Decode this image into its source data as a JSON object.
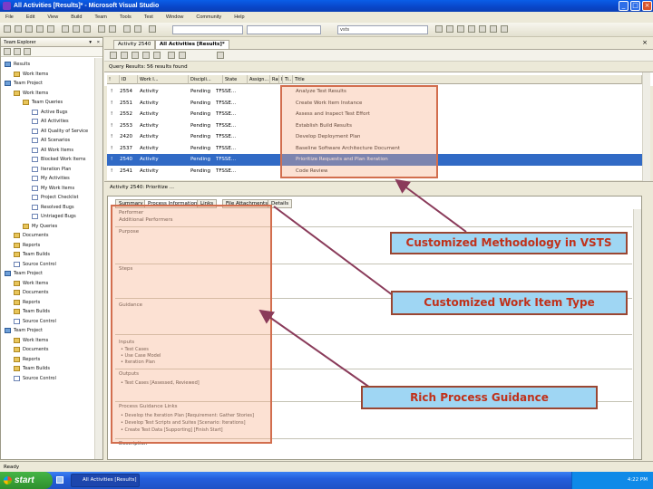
{
  "window": {
    "title": "All Activities [Results]* - Microsoft Visual Studio",
    "controls": [
      "_",
      "□",
      "×"
    ]
  },
  "menu": [
    "File",
    "Edit",
    "View",
    "Build",
    "Team",
    "Tools",
    "Test",
    "Window",
    "Community",
    "Help"
  ],
  "toolbar": {
    "config_value": "",
    "target_value": "vsts"
  },
  "team_explorer": {
    "title": "Team Explorer",
    "items": [
      {
        "label": "Results",
        "indent": 0,
        "icon": "server"
      },
      {
        "label": "Work Items",
        "indent": 1,
        "icon": "folder"
      },
      {
        "label": "Team Project",
        "indent": 0,
        "icon": "server"
      },
      {
        "label": "Work Items",
        "indent": 1,
        "icon": "folder"
      },
      {
        "label": "Team Queries",
        "indent": 2,
        "icon": "folder"
      },
      {
        "label": "Active Bugs",
        "indent": 3,
        "icon": "page"
      },
      {
        "label": "All Activities",
        "indent": 3,
        "icon": "page"
      },
      {
        "label": "All Quality of Service",
        "indent": 3,
        "icon": "page"
      },
      {
        "label": "All Scenarios",
        "indent": 3,
        "icon": "page"
      },
      {
        "label": "All Work Items",
        "indent": 3,
        "icon": "page"
      },
      {
        "label": "Blocked Work Items",
        "indent": 3,
        "icon": "page"
      },
      {
        "label": "Iteration Plan",
        "indent": 3,
        "icon": "page"
      },
      {
        "label": "My Activities",
        "indent": 3,
        "icon": "page"
      },
      {
        "label": "My Work Items",
        "indent": 3,
        "icon": "page"
      },
      {
        "label": "Project Checklist",
        "indent": 3,
        "icon": "page"
      },
      {
        "label": "Resolved Bugs",
        "indent": 3,
        "icon": "page"
      },
      {
        "label": "Untriaged Bugs",
        "indent": 3,
        "icon": "page"
      },
      {
        "label": "My Queries",
        "indent": 2,
        "icon": "folder"
      },
      {
        "label": "Documents",
        "indent": 1,
        "icon": "folder"
      },
      {
        "label": "Reports",
        "indent": 1,
        "icon": "folder"
      },
      {
        "label": "Team Builds",
        "indent": 1,
        "icon": "folder"
      },
      {
        "label": "Source Control",
        "indent": 1,
        "icon": "page"
      },
      {
        "label": "Team Project",
        "indent": 0,
        "icon": "server"
      },
      {
        "label": "Work Items",
        "indent": 1,
        "icon": "folder"
      },
      {
        "label": "Documents",
        "indent": 1,
        "icon": "folder"
      },
      {
        "label": "Reports",
        "indent": 1,
        "icon": "folder"
      },
      {
        "label": "Team Builds",
        "indent": 1,
        "icon": "folder"
      },
      {
        "label": "Source Control",
        "indent": 1,
        "icon": "page"
      },
      {
        "label": "Team Project",
        "indent": 0,
        "icon": "server"
      },
      {
        "label": "Work Items",
        "indent": 1,
        "icon": "folder"
      },
      {
        "label": "Documents",
        "indent": 1,
        "icon": "folder"
      },
      {
        "label": "Reports",
        "indent": 1,
        "icon": "folder"
      },
      {
        "label": "Team Builds",
        "indent": 1,
        "icon": "folder"
      },
      {
        "label": "Source Control",
        "indent": 1,
        "icon": "page"
      }
    ]
  },
  "doc_tabs": [
    "Activity 2540",
    "All Activities [Results]*"
  ],
  "results_header": "Query Results: 56 results found",
  "grid": {
    "columns": [
      "!",
      "ID",
      "Work I...",
      "Discipli...",
      "State",
      "Assign...",
      "Rank",
      "Iter...",
      "Ti...",
      "Title"
    ],
    "rows": [
      {
        "id": "2554",
        "type": "Activity",
        "state": "Pending",
        "assigned": "TFSSE...",
        "title": "Analyze Test Results",
        "selected": false
      },
      {
        "id": "2551",
        "type": "Activity",
        "state": "Pending",
        "assigned": "TFSSE...",
        "title": "Create Work Item Instance",
        "selected": false
      },
      {
        "id": "2552",
        "type": "Activity",
        "state": "Pending",
        "assigned": "TFSSE...",
        "title": "Assess and Inspect Test Effort",
        "selected": false
      },
      {
        "id": "2553",
        "type": "Activity",
        "state": "Pending",
        "assigned": "TFSSE...",
        "title": "Establish Build Results",
        "selected": false
      },
      {
        "id": "2420",
        "type": "Activity",
        "state": "Pending",
        "assigned": "TFSSE...",
        "title": "Develop Deployment Plan",
        "selected": false
      },
      {
        "id": "2537",
        "type": "Activity",
        "state": "Pending",
        "assigned": "TFSSE...",
        "title": "Baseline Software Architecture Document",
        "selected": false
      },
      {
        "id": "2540",
        "type": "Activity",
        "state": "Pending",
        "assigned": "TFSSE...",
        "title": "Prioritize Requests and Plan Iteration",
        "selected": true
      },
      {
        "id": "2541",
        "type": "Activity",
        "state": "Pending",
        "assigned": "TFSSE...",
        "title": "Code Review",
        "selected": false
      }
    ]
  },
  "activity_header": "Activity 2540: Prioritize ...",
  "form_tabs": [
    "Summary",
    "Process Information",
    "Links",
    "File Attachments",
    "Details"
  ],
  "form": {
    "fields": [
      "Performer",
      "Additional Performers"
    ],
    "sections": [
      "Purpose",
      "Steps",
      "Guidance",
      "Inputs",
      "Outputs",
      "Process Guidance Links",
      "Description"
    ],
    "inputs_list": [
      "Test Cases",
      "Use Case Model",
      "Iteration Plan"
    ],
    "outputs_list": [
      "Test Cases [Assessed, Reviewed]"
    ],
    "guidance_links": [
      "Develop the Iteration Plan [Requirement: Gather Stories]",
      "Develop Test Scripts and Suites [Scenario: Iterations]",
      "Create Test Data [Supporting] [Finish Start]"
    ]
  },
  "callouts": {
    "methodology": "Customized Methodology in VSTS",
    "work_item_type": "Customized Work Item Type",
    "guidance": "Rich Process Guidance"
  },
  "status": "Ready",
  "taskbar": {
    "start": "start",
    "task": "All Activities [Results]",
    "clock": "4:22 PM"
  }
}
